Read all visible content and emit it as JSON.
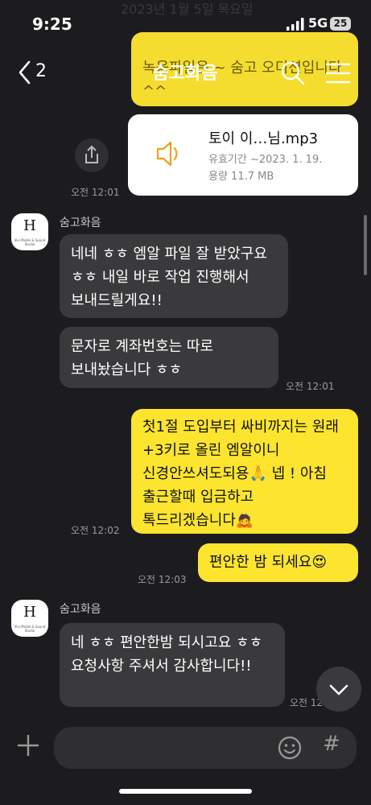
{
  "status_bar": {
    "time": "9:25",
    "date_ghost": "2023년 1월 5일 목요일",
    "network": "5G",
    "battery": "25"
  },
  "nav": {
    "back_count": "2",
    "title": "숨고화음",
    "icons": [
      "search-icon",
      "menu-icon"
    ]
  },
  "chat": {
    "partial_top_message": "녹음파일은 ~ 숨고 오디션입니다 ^^",
    "file_card": {
      "name": "토이 이…님.mp3",
      "expiry": "유효기간  ~2023. 1. 19.",
      "size": "용량  11.7 MB",
      "time": "오전 12:01"
    },
    "sender_1": "숨고화음",
    "avatar_letter": "H",
    "avatar_sub": "Vivi Model & Sound Studio",
    "msg_1": "네네 ㅎㅎ 엠알 파일 잘 받았구요 ㅎㅎ 내일 바로 작업 진행해서 보내드릴게요!!",
    "msg_2": "문자로 계좌번호는 따로 보내놨습니다 ㅎㅎ",
    "msg_2_time": "오전 12:01",
    "my_msg_1": "첫1절 도입부터 싸비까지는 원래 +3키로 올린 엠알이니 신경안쓰셔도되용🙏 넵 ! 아침 출근할때 입금하고 톡드리겠습니다🙇",
    "my_msg_1_time": "오전 12:02",
    "my_msg_2": "편안한 밤 되세요😍",
    "my_msg_2_time": "오전 12:03",
    "sender_2": "숨고화음",
    "msg_3": "네 ㅎㅎ 편안한밤 되시고요 ㅎㅎ 요청사항 주셔서 감사합니다!!",
    "msg_3_time": "오전 12:0"
  },
  "input": {
    "placeholder": ""
  },
  "colors": {
    "my_bubble": "#fde52f",
    "other_bubble": "#3a3a3c",
    "background": "#1c1c1e"
  }
}
